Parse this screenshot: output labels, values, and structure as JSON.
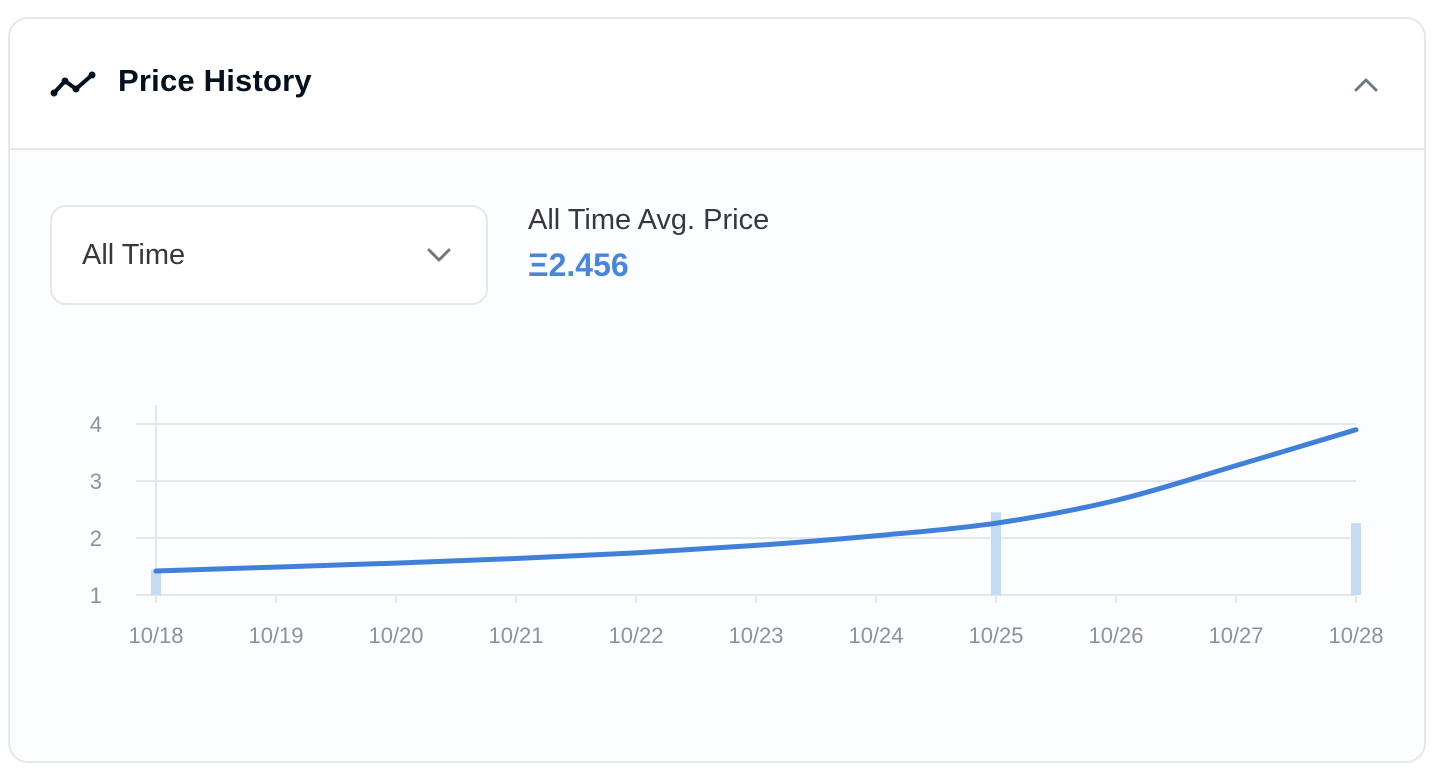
{
  "header": {
    "title": "Price History",
    "icon": "line-chart-icon",
    "collapse_icon": "chevron-up-icon"
  },
  "filter": {
    "selected": "All Time",
    "icon": "chevron-down-icon"
  },
  "stats": {
    "avg_label": "All Time Avg. Price",
    "avg_value": "Ξ2.456"
  },
  "colors": {
    "line": "#4180d9",
    "volume_bar": "#c5dbf2",
    "accent": "#4a86d8",
    "grid": "#e5e8eb"
  },
  "chart_data": {
    "type": "line",
    "x": [
      "10/18",
      "10/19",
      "10/20",
      "10/21",
      "10/22",
      "10/23",
      "10/24",
      "10/25",
      "10/26",
      "10/27",
      "10/28"
    ],
    "y_ticks": [
      1,
      2,
      3,
      4
    ],
    "ylim": [
      1,
      4.3
    ],
    "series": [
      {
        "values": [
          1.42,
          1.49,
          1.56,
          1.64,
          1.74,
          1.87,
          2.04,
          2.26,
          2.66,
          3.27,
          3.9
        ]
      }
    ],
    "volume_bars": [
      {
        "x": "10/18",
        "value": 1.45
      },
      {
        "x": "10/25",
        "value": 2.45
      },
      {
        "x": "10/28",
        "value": 2.26
      }
    ],
    "grid": true,
    "title": "",
    "xlabel": "",
    "ylabel": ""
  }
}
